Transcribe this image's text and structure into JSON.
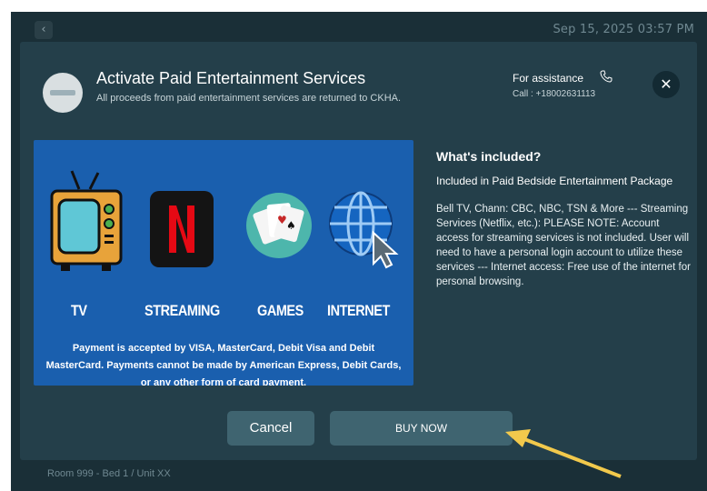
{
  "topbar": {
    "back_icon": "chevron-left-icon",
    "datetime": "Sep 15, 2025  03:57 PM"
  },
  "dialog": {
    "title": "Activate Paid Entertainment Services",
    "subtitle": "All proceeds from paid entertainment services are returned to CKHA.",
    "assistance_label": "For assistance",
    "assistance_icon": "phone-icon",
    "call_text": "Call : +18002631113",
    "close_icon": "close-icon"
  },
  "banner": {
    "services": [
      {
        "label": "TV",
        "icon": "tv-icon"
      },
      {
        "label": "STREAMING",
        "icon": "netflix-icon"
      },
      {
        "label": "GAMES",
        "icon": "cards-icon"
      },
      {
        "label": "INTERNET",
        "icon": "globe-cursor-icon"
      }
    ],
    "payment_note": "Payment is accepted by VISA, MasterCard, Debit Visa and Debit MasterCard. Payments cannot be made by American Express, Debit Cards, or any other form of card payment."
  },
  "info": {
    "heading": "What's included?",
    "package": "Included in Paid Bedside Entertainment Package",
    "body": "Bell TV, Chann: CBC, NBC, TSN & More --- Streaming Services (Netflix, etc.): PLEASE NOTE: Account access for streaming services is not included. User will need to have a personal login account to utilize these services --- Internet access: Free use of the internet for personal browsing."
  },
  "buttons": {
    "cancel": "Cancel",
    "buy": "BUY NOW"
  },
  "footer": {
    "room": "Room 999  -  Bed  1 / Unit XX"
  },
  "colors": {
    "background": "#1a2f37",
    "dialog": "#243f4a",
    "banner": "#1a5fae",
    "button": "#3f6470",
    "arrow": "#f2c94c"
  }
}
